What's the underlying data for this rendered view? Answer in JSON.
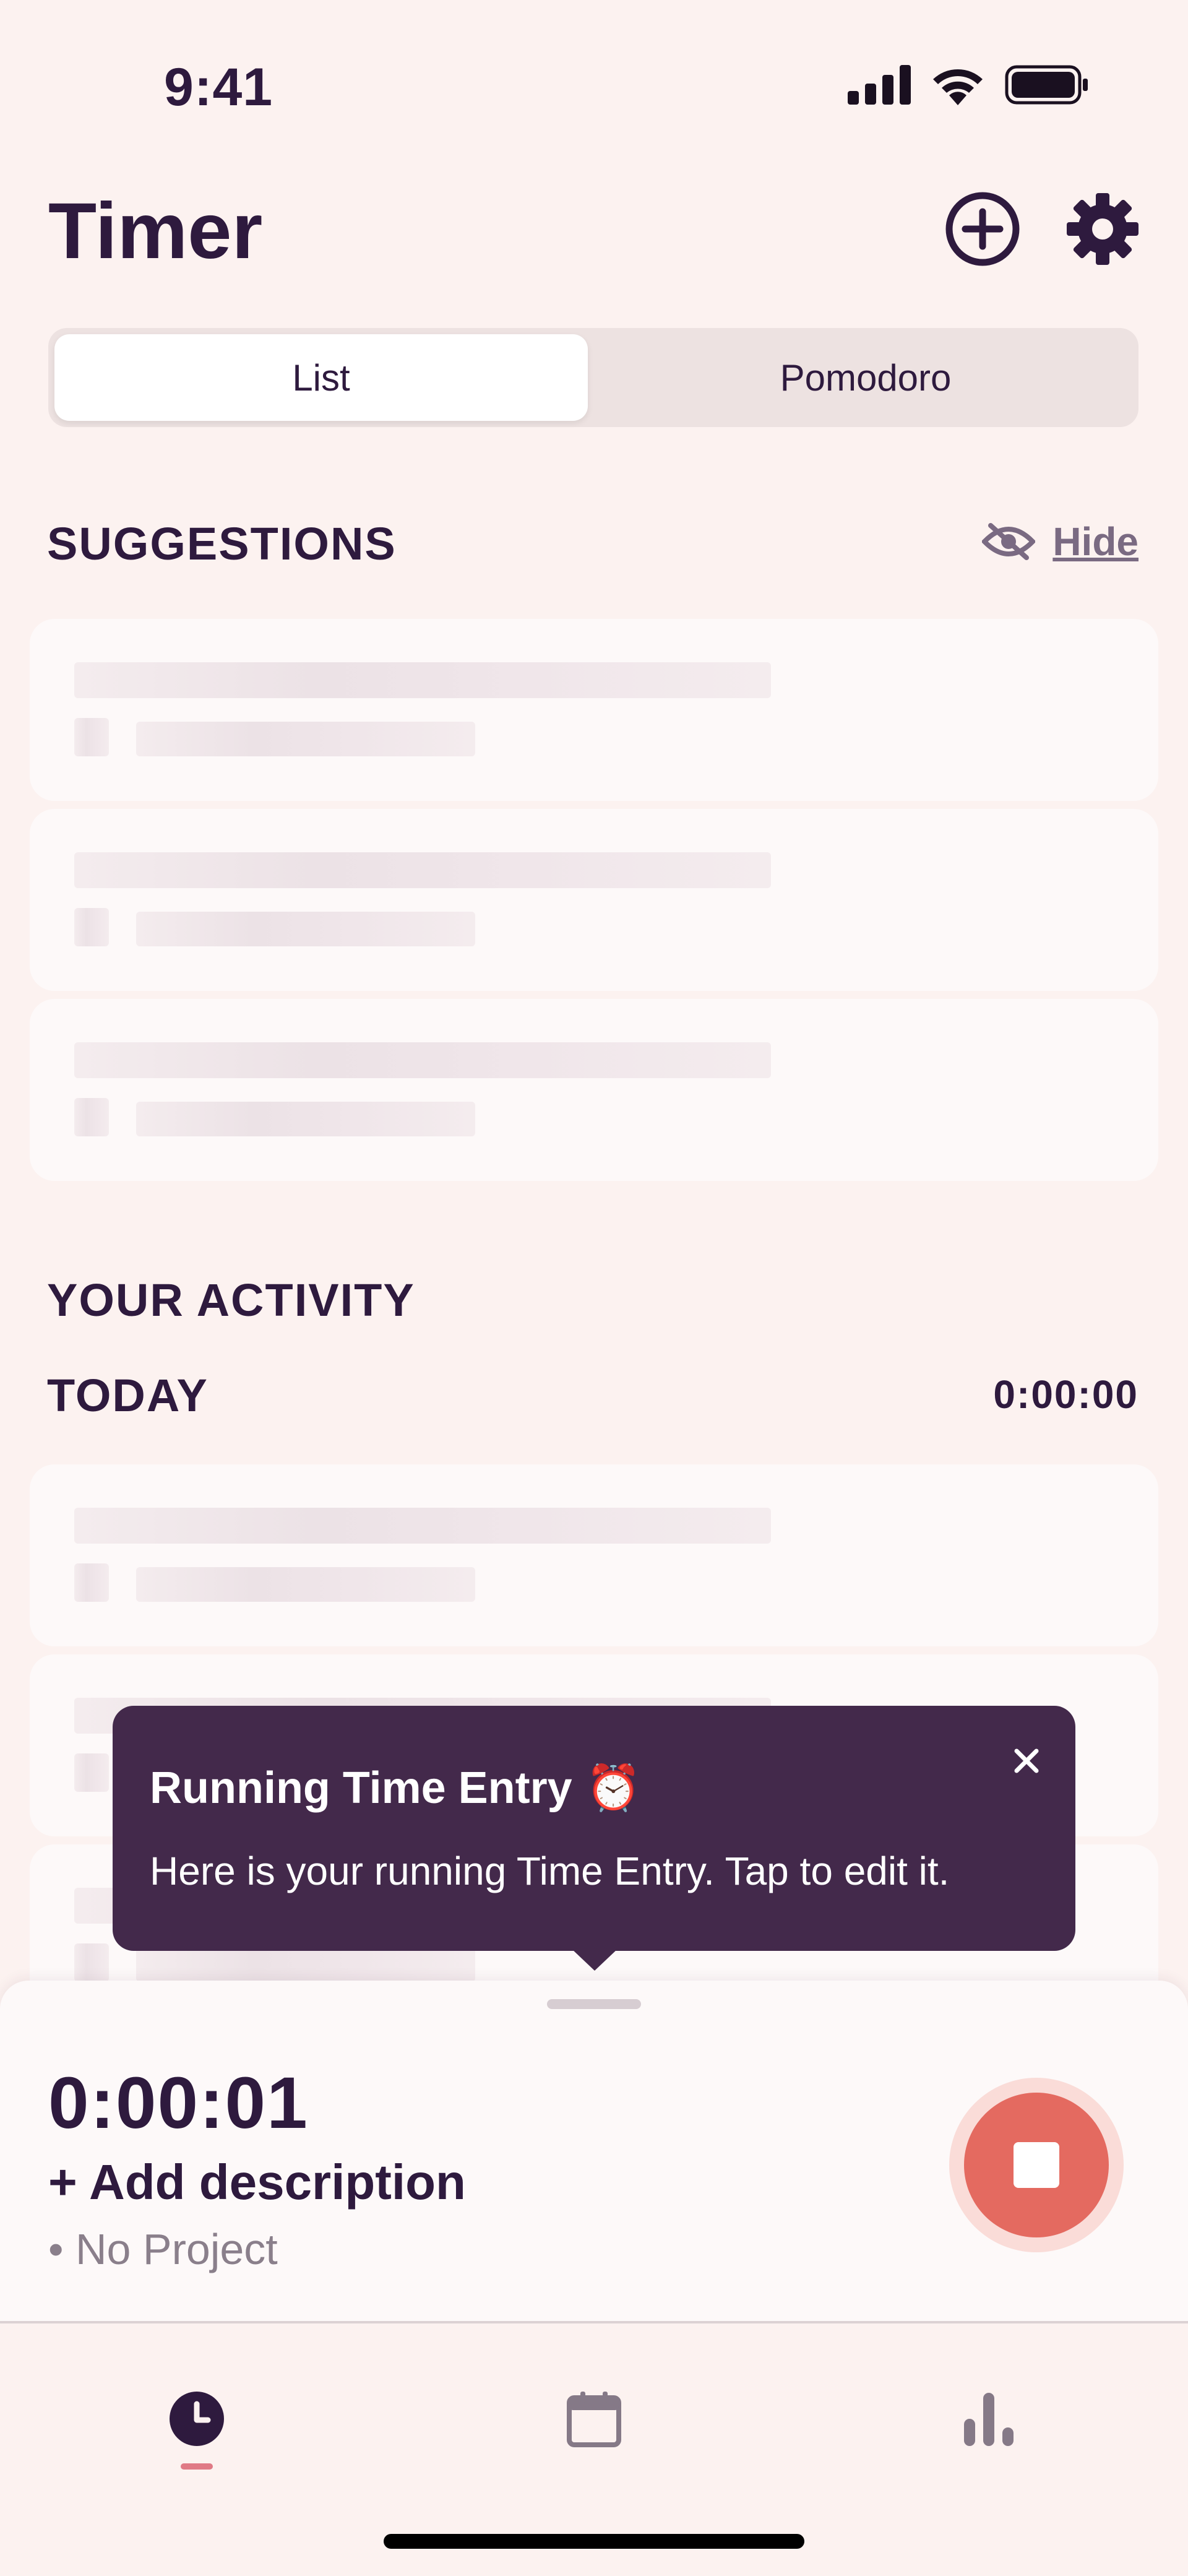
{
  "status_bar": {
    "time": "9:41"
  },
  "header": {
    "title": "Timer"
  },
  "segmented": {
    "active": "List",
    "inactive": "Pomodoro"
  },
  "suggestions": {
    "heading": "SUGGESTIONS",
    "hide_label": "Hide"
  },
  "activity": {
    "heading": "YOUR ACTIVITY",
    "today_label": "TODAY",
    "today_total": "0:00:00"
  },
  "tooltip": {
    "title": "Running Time Entry",
    "emoji": "⏰",
    "body": "Here is your running Time Entry. Tap to edit it."
  },
  "running_entry": {
    "duration": "0:00:01",
    "description": "+ Add description",
    "project": "• No Project"
  },
  "colors": {
    "background": "#fcf2f0",
    "text": "#2e1a3e",
    "tooltip": "#43294b",
    "stop_button": "#e46a60",
    "tab_indicator": "#e07a86"
  },
  "icons": {
    "header": [
      "add-circle-icon",
      "gear-icon"
    ],
    "tabs": [
      "clock-icon",
      "calendar-icon",
      "bar-chart-icon"
    ]
  }
}
